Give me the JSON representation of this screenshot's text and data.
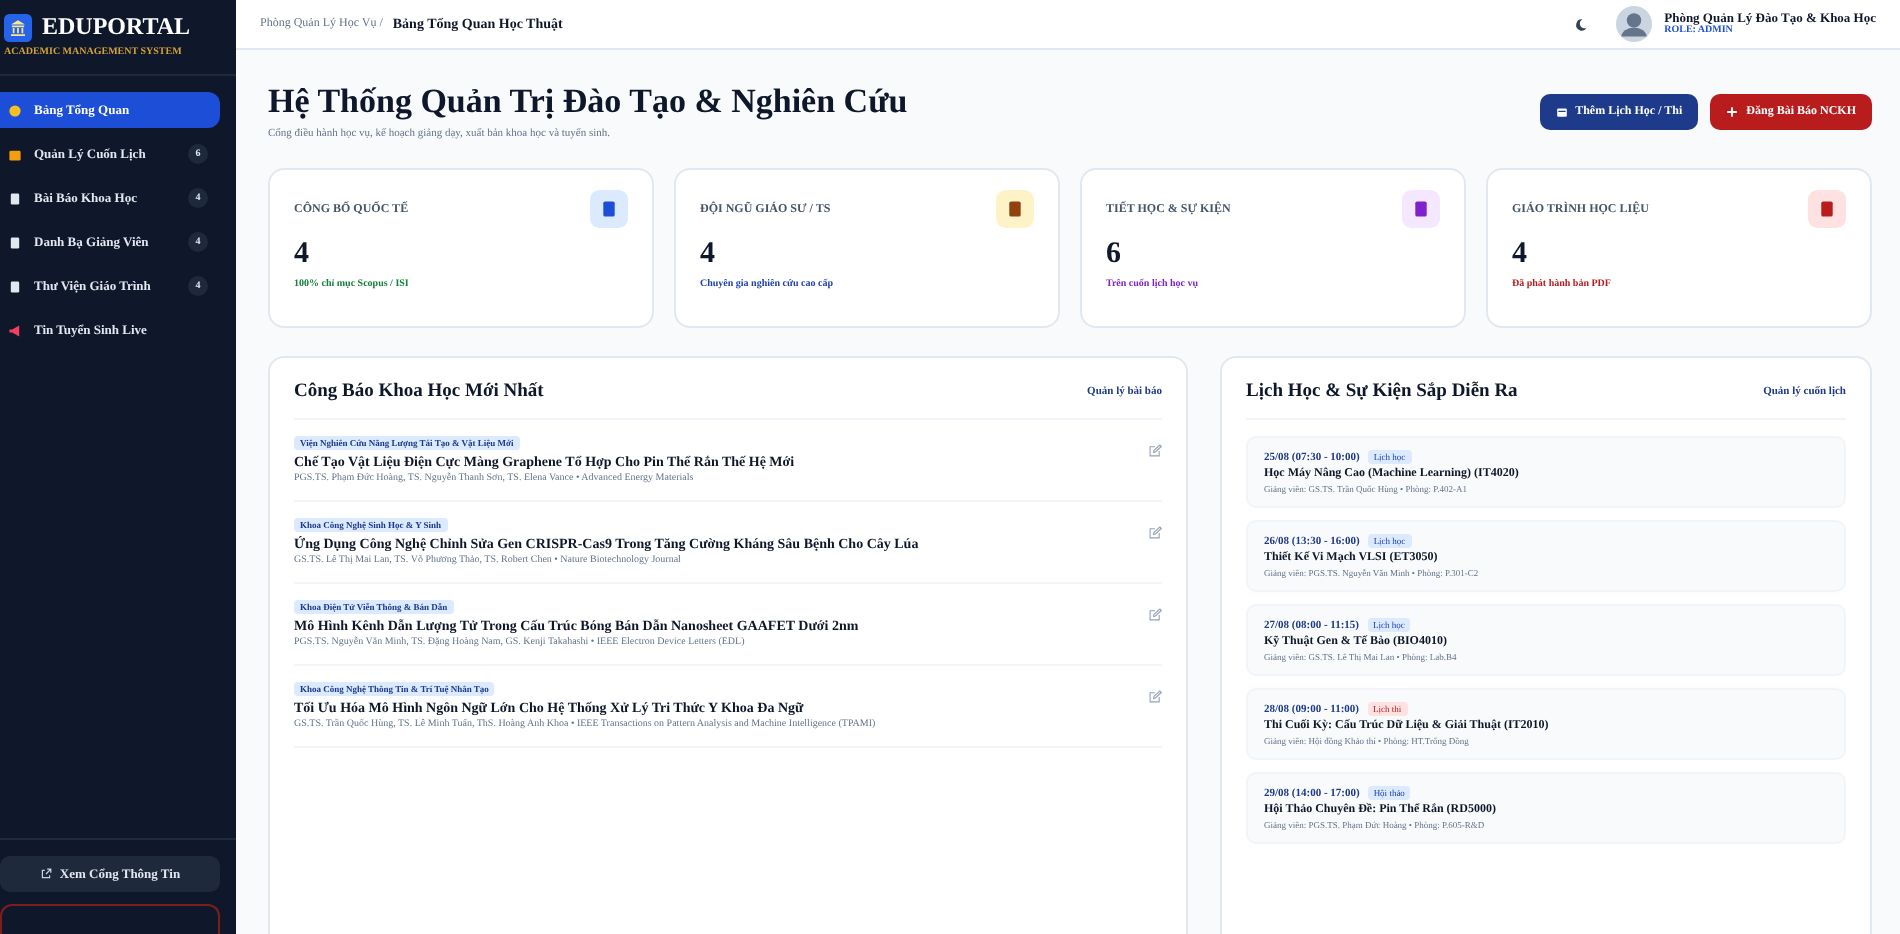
{
  "brand": {
    "name": "EDUPORTAL",
    "tagline": "ACADEMIC MANAGEMENT SYSTEM"
  },
  "sidebar": {
    "items": [
      {
        "label": "Bảng Tổng Quan",
        "selected": true,
        "kind": "dashboard"
      },
      {
        "label": "Quản Lý Cuốn Lịch",
        "badge": "6",
        "selected": false,
        "kind": "calendar"
      },
      {
        "label": "Bài Báo Khoa Học",
        "badge": "4",
        "selected": false,
        "kind": "paper"
      },
      {
        "label": "Danh Bạ Giảng Viên",
        "badge": "4",
        "selected": false,
        "kind": "people"
      },
      {
        "label": "Thư Viện Giáo Trình",
        "badge": "4",
        "selected": false,
        "kind": "book"
      },
      {
        "label": "Tin Tuyển Sinh Live",
        "selected": false,
        "kind": "megaphone"
      }
    ],
    "footer_button": "Xem Cổng Thông Tin"
  },
  "breadcrumb": {
    "parent": "Phòng Quản Lý Học Vụ /",
    "current": "Bảng Tổng Quan Học Thuật"
  },
  "user": {
    "name": "Phòng Quản Lý Đào Tạo & Khoa Học",
    "role": "ROLE: ADMIN"
  },
  "page": {
    "title": "Hệ Thống Quản Trị Đào Tạo & Nghiên Cứu",
    "subtitle": "Cổng điều hành học vụ, kế hoạch giảng dạy, xuất bản khoa học và tuyển sinh.",
    "buttons": [
      {
        "label": "Thêm Lịch Học / Thi",
        "kind": "calendar"
      },
      {
        "label": "Đăng Bài Báo NCKH",
        "kind": "plus"
      }
    ]
  },
  "stats": [
    {
      "label": "CÔNG BỐ QUỐC TẾ",
      "value": "4",
      "note": "100% chỉ mục Scopus / ISI",
      "color": "#15803d",
      "kind": "paper"
    },
    {
      "label": "ĐỘI NGŨ GIÁO SƯ / TS",
      "value": "4",
      "note": "Chuyên gia nghiên cứu cao cấp",
      "color": "#1e40af",
      "kind": "people"
    },
    {
      "label": "TIẾT HỌC & SỰ KIỆN",
      "value": "6",
      "note": "Trên cuốn lịch học vụ",
      "color": "#7e22ce",
      "kind": "calendar"
    },
    {
      "label": "GIÁO TRÌNH HỌC LIỆU",
      "value": "4",
      "note": "Đã phát hành bản PDF",
      "color": "#b91c1c",
      "kind": "pdf"
    }
  ],
  "papers": {
    "title": "Công Báo Khoa Học Mới Nhất",
    "link": "Quản lý bài báo",
    "items": [
      {
        "tag": "Viện Nghiên Cứu Năng Lượng Tái Tạo & Vật Liệu Mới",
        "title": "Chế Tạo Vật Liệu Điện Cực Màng Graphene Tổ Hợp Cho Pin Thể Rắn Thế Hệ Mới",
        "meta": "PGS.TS. Phạm Đức Hoàng, TS. Nguyễn Thanh Sơn, TS. Elena Vance • Advanced Energy Materials"
      },
      {
        "tag": "Khoa Công Nghệ Sinh Học & Y Sinh",
        "title": "Ứng Dụng Công Nghệ Chỉnh Sửa Gen CRISPR-Cas9 Trong Tăng Cường Kháng Sâu Bệnh Cho Cây Lúa",
        "meta": "GS.TS. Lê Thị Mai Lan, TS. Võ Phương Thảo, TS. Robert Chen • Nature Biotechnology Journal"
      },
      {
        "tag": "Khoa Điện Tử Viễn Thông & Bán Dẫn",
        "title": "Mô Hình Kênh Dẫn Lượng Tử Trong Cấu Trúc Bóng Bán Dẫn Nanosheet GAAFET Dưới 2nm",
        "meta": "PGS.TS. Nguyễn Văn Minh, TS. Đặng Hoàng Nam, GS. Kenji Takahashi • IEEE Electron Device Letters (EDL)"
      },
      {
        "tag": "Khoa Công Nghệ Thông Tin & Trí Tuệ Nhân Tạo",
        "title": "Tối Ưu Hóa Mô Hình Ngôn Ngữ Lớn Cho Hệ Thống Xử Lý Tri Thức Y Khoa Đa Ngữ",
        "meta": "GS.TS. Trần Quốc Hùng, TS. Lê Minh Tuấn, ThS. Hoàng Anh Khoa • IEEE Transactions on Pattern Analysis and Machine Intelligence (TPAMI)"
      }
    ]
  },
  "schedule": {
    "title": "Lịch Học & Sự Kiện Sắp Diễn Ra",
    "link": "Quản lý cuốn lịch",
    "items": [
      {
        "time": "25/08 (07:30 - 10:00)",
        "tag": "Lịch học",
        "kind": "class",
        "title": "Học Máy Nâng Cao (Machine Learning) (IT4020)",
        "meta": "Giảng viên: GS.TS. Trần Quốc Hùng • Phòng: P.402-A1"
      },
      {
        "time": "26/08 (13:30 - 16:00)",
        "tag": "Lịch học",
        "kind": "class",
        "title": "Thiết Kế Vi Mạch VLSI (ET3050)",
        "meta": "Giảng viên: PGS.TS. Nguyễn Văn Minh • Phòng: P.301-C2"
      },
      {
        "time": "27/08 (08:00 - 11:15)",
        "tag": "Lịch học",
        "kind": "class",
        "title": "Kỹ Thuật Gen & Tế Bào (BIO4010)",
        "meta": "Giảng viên: GS.TS. Lê Thị Mai Lan • Phòng: Lab.B4"
      },
      {
        "time": "28/08 (09:00 - 11:00)",
        "tag": "Lịch thi",
        "kind": "exam",
        "title": "Thi Cuối Kỳ: Cấu Trúc Dữ Liệu & Giải Thuật (IT2010)",
        "meta": "Giảng viên: Hội đồng Khảo thí • Phòng: HT.Trống Đồng"
      },
      {
        "time": "29/08 (14:00 - 17:00)",
        "tag": "Hội thảo",
        "kind": "seminar",
        "title": "Hội Thảo Chuyên Đề: Pin Thể Rắn (RD5000)",
        "meta": "Giảng viên: PGS.TS. Phạm Đức Hoàng • Phòng: P.605-R&D"
      }
    ]
  }
}
